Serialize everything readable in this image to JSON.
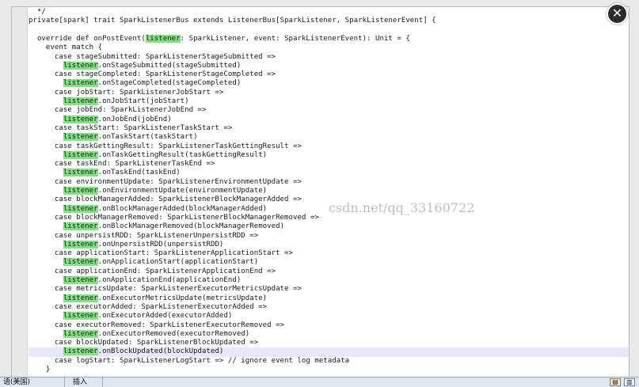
{
  "editor": {
    "current_line": 38,
    "highlight_word": "listener",
    "lines": [
      "  */",
      "private[spark] trait SparkListenerBus extends ListenerBus[SparkListener, SparkListenerEvent] {",
      "",
      "  override def onPostEvent(listener: SparkListener, event: SparkListenerEvent): Unit = {",
      "    event match {",
      "      case stageSubmitted: SparkListenerStageSubmitted =>",
      "        listener.onStageSubmitted(stageSubmitted)",
      "      case stageCompleted: SparkListenerStageCompleted =>",
      "        listener.onStageCompleted(stageCompleted)",
      "      case jobStart: SparkListenerJobStart =>",
      "        listener.onJobStart(jobStart)",
      "      case jobEnd: SparkListenerJobEnd =>",
      "        listener.onJobEnd(jobEnd)",
      "      case taskStart: SparkListenerTaskStart =>",
      "        listener.onTaskStart(taskStart)",
      "      case taskGettingResult: SparkListenerTaskGettingResult =>",
      "        listener.onTaskGettingResult(taskGettingResult)",
      "      case taskEnd: SparkListenerTaskEnd =>",
      "        listener.onTaskEnd(taskEnd)",
      "      case environmentUpdate: SparkListenerEnvironmentUpdate =>",
      "        listener.onEnvironmentUpdate(environmentUpdate)",
      "      case blockManagerAdded: SparkListenerBlockManagerAdded =>",
      "        listener.onBlockManagerAdded(blockManagerAdded)",
      "      case blockManagerRemoved: SparkListenerBlockManagerRemoved =>",
      "        listener.onBlockManagerRemoved(blockManagerRemoved)",
      "      case unpersistRDD: SparkListenerUnpersistRDD =>",
      "        listener.onUnpersistRDD(unpersistRDD)",
      "      case applicationStart: SparkListenerApplicationStart =>",
      "        listener.onApplicationStart(applicationStart)",
      "      case applicationEnd: SparkListenerApplicationEnd =>",
      "        listener.onApplicationEnd(applicationEnd)",
      "      case metricsUpdate: SparkListenerExecutorMetricsUpdate =>",
      "        listener.onExecutorMetricsUpdate(metricsUpdate)",
      "      case executorAdded: SparkListenerExecutorAdded =>",
      "        listener.onExecutorAdded(executorAdded)",
      "      case executorRemoved: SparkListenerExecutorRemoved =>",
      "        listener.onExecutorRemoved(executorRemoved)",
      "      case blockUpdated: SparkListenerBlockUpdated =>",
      "        listener.onBlockUpdated(blockUpdated)",
      "      case logStart: SparkListenerLogStart => // ignore event log metadata",
      "    }"
    ]
  },
  "watermark": "csdn.net/qq_33160722",
  "close_icon_glyph": "✕",
  "statusbar": {
    "language": "语(美国)",
    "mode": "插入",
    "view_icons": [
      "print-layout-icon",
      "reading-view-icon"
    ],
    "view_glyphs": [
      "▤",
      "▥"
    ]
  }
}
